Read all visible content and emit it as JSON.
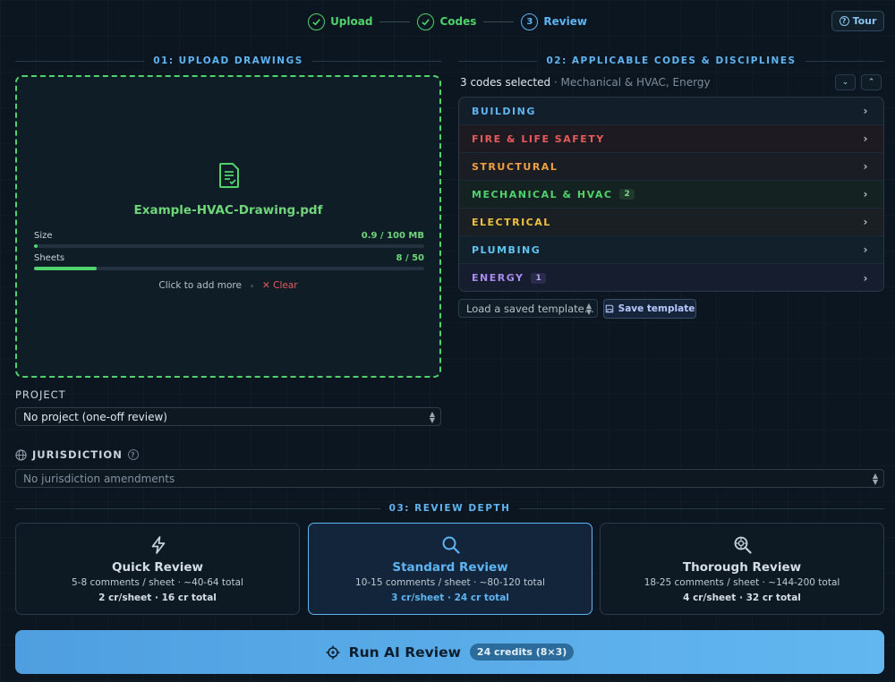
{
  "stepper": {
    "steps": [
      {
        "label": "Upload",
        "state": "done"
      },
      {
        "label": "Codes",
        "state": "done"
      },
      {
        "label": "Review",
        "number": "3",
        "state": "active"
      }
    ]
  },
  "tour_label": "Tour",
  "upload": {
    "heading": "01: UPLOAD DRAWINGS",
    "file_name": "Example-HVAC-Drawing.pdf",
    "size_label": "Size",
    "size_value": "0.9 / 100 MB",
    "size_fraction": 0.009,
    "sheets_label": "Sheets",
    "sheets_value": "8 / 50",
    "sheets_fraction": 0.16,
    "add_more": "Click to add more",
    "clear": "Clear"
  },
  "project": {
    "label": "PROJECT",
    "value": "No project (one-off review)"
  },
  "jurisdiction": {
    "label": "JURISDICTION",
    "value": "No jurisdiction amendments"
  },
  "codes": {
    "heading": "02: APPLICABLE CODES & DISCIPLINES",
    "summary": "3 codes selected",
    "summary_detail": " · Mechanical & HVAC, Energy",
    "items": [
      {
        "label": "BUILDING",
        "color": "#5fb4f2",
        "bg": "#121f2b"
      },
      {
        "label": "FIRE & LIFE SAFETY",
        "color": "#e85a5a",
        "bg": "#1d1a22"
      },
      {
        "label": "STRUCTURAL",
        "color": "#f0a040",
        "bg": "#1a1e24"
      },
      {
        "label": "MECHANICAL & HVAC",
        "color": "#4fd36a",
        "bg": "#142221",
        "count": "2"
      },
      {
        "label": "ELECTRICAL",
        "color": "#f0c040",
        "bg": "#1a1f24"
      },
      {
        "label": "PLUMBING",
        "color": "#5fc4f2",
        "bg": "#12202c"
      },
      {
        "label": "ENERGY",
        "color": "#a98cf2",
        "bg": "#161d2e",
        "count": "1"
      }
    ],
    "template_placeholder": "Load a saved template...",
    "save_template": "Save template"
  },
  "depth": {
    "heading": "03: REVIEW DEPTH",
    "options": [
      {
        "title": "Quick Review",
        "desc": "5-8 comments / sheet · ~40-64 total",
        "cost": "2 cr/sheet · 16 cr total",
        "icon": "bolt-icon"
      },
      {
        "title": "Standard Review",
        "desc": "10-15 comments / sheet · ~80-120 total",
        "cost": "3 cr/sheet · 24 cr total",
        "icon": "search-icon",
        "selected": true
      },
      {
        "title": "Thorough Review",
        "desc": "18-25 comments / sheet · ~144-200 total",
        "cost": "4 cr/sheet · 32 cr total",
        "icon": "zoom-detail-icon"
      }
    ]
  },
  "run": {
    "label": "Run AI Review",
    "credits": "24 credits (8×3)"
  }
}
